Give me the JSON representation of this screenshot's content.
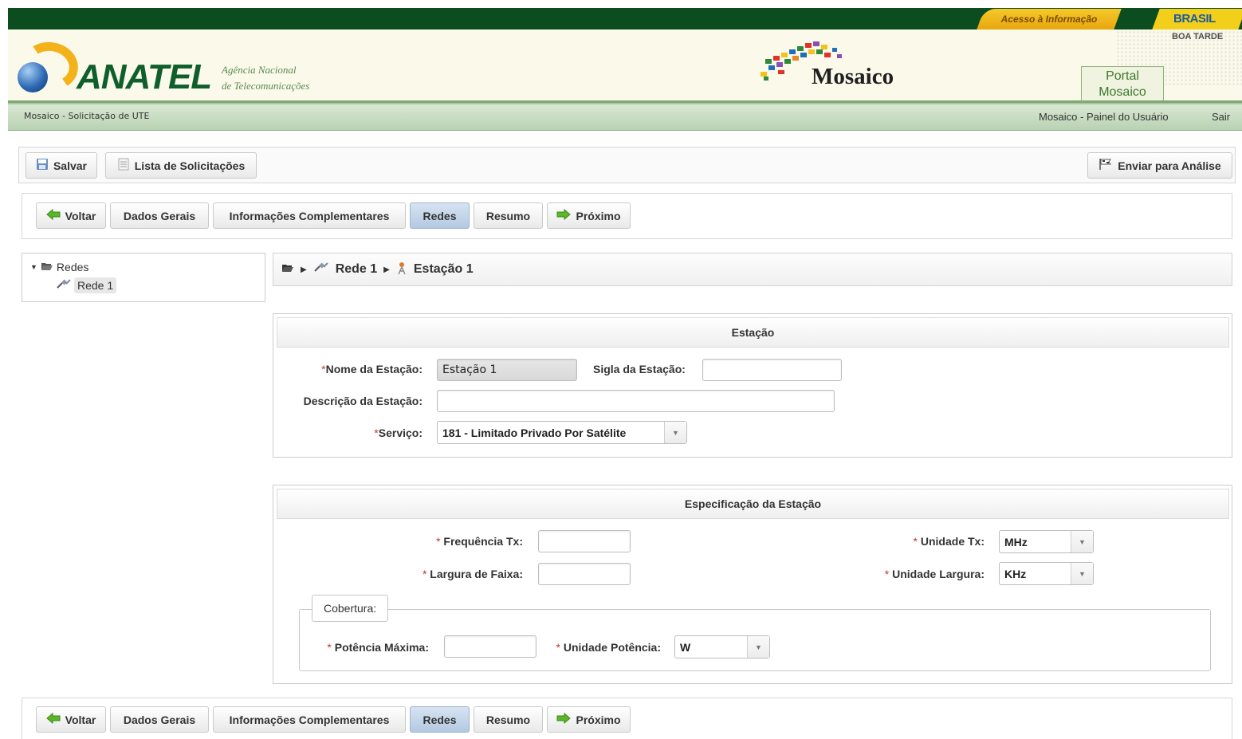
{
  "top": {
    "acesso_label": "Acesso à Informação",
    "brasil_label": "BRASIL",
    "greeting": "BOA TARDE"
  },
  "header": {
    "brand": "ANATEL",
    "agency_line1": "Agência Nacional",
    "agency_line2": "de Telecomunicações",
    "system_name": "Mosaico",
    "portal_line1": "Portal",
    "portal_line2": "Mosaico"
  },
  "subbar": {
    "page_context": "Mosaico - Solicitação de UTE",
    "user_panel_link": "Mosaico - Painel do Usuário",
    "logout_link": "Sair"
  },
  "toolbar": {
    "save_label": "Salvar",
    "list_label": "Lista de Solicitações",
    "send_label": "Enviar para Análise"
  },
  "nav": {
    "back_label": "Voltar",
    "general_label": "Dados Gerais",
    "complementary_label": "Informações Complementares",
    "networks_label": "Redes",
    "summary_label": "Resumo",
    "next_label": "Próximo"
  },
  "tree": {
    "root_label": "Redes",
    "child_label": "Rede 1"
  },
  "breadcrumb": {
    "network": "Rede 1",
    "station": "Estação 1"
  },
  "station_panel": {
    "title": "Estação",
    "name_label": "Nome da Estação:",
    "name_value": "Estação 1",
    "acronym_label": "Sigla da Estação:",
    "acronym_value": "",
    "description_label": "Descrição da Estação:",
    "description_value": "",
    "service_label": "Serviço:",
    "service_value": "181 - Limitado Privado Por Satélite"
  },
  "spec_panel": {
    "title": "Especificação da Estação",
    "freq_tx_label": "Frequência Tx:",
    "freq_tx_value": "",
    "unit_tx_label": "Unidade Tx:",
    "unit_tx_value": "MHz",
    "bandwidth_label": "Largura de Faixa:",
    "bandwidth_value": "",
    "unit_bandwidth_label": "Unidade Largura:",
    "unit_bandwidth_value": "KHz",
    "coverage_legend": "Cobertura:",
    "max_power_label": "Potência Máxima:",
    "max_power_value": "",
    "unit_power_label": "Unidade Potência:",
    "unit_power_value": "W"
  },
  "required_marker": "*",
  "colors": {
    "top_bar": "#0b4d1e",
    "brand_green": "#0f5e2c",
    "accent_yellow": "#f3b21a",
    "active_tab": "#b3c9e2",
    "required": "#c0392b"
  }
}
